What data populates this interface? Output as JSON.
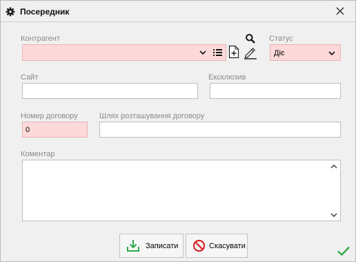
{
  "window": {
    "title": "Посередник"
  },
  "icons": {
    "title": "gear-icon",
    "close": "close-icon",
    "list": "list-icon",
    "add": "add-document-icon",
    "search": "search-icon",
    "edit": "pencil-icon",
    "save": "download-tray-icon",
    "cancel": "no-entry-icon",
    "ok": "checkmark-icon"
  },
  "colors": {
    "required_bg": "#fdd9da",
    "save_icon": "#2ea84a",
    "cancel_icon": "#d9262b",
    "checkmark": "#2ea84a"
  },
  "form": {
    "counterparty": {
      "label": "Контрагент",
      "value": ""
    },
    "status": {
      "label": "Статус",
      "value": "Діє"
    },
    "site": {
      "label": "Сайт",
      "value": ""
    },
    "exclusive": {
      "label": "Ексклюзив",
      "value": ""
    },
    "contract_number": {
      "label": "Номер договору",
      "value": "0"
    },
    "contract_path": {
      "label": "Шлях розташування договору",
      "value": ""
    },
    "comment": {
      "label": "Коментар",
      "value": ""
    }
  },
  "buttons": {
    "save": "Записати",
    "cancel": "Скасувати"
  }
}
